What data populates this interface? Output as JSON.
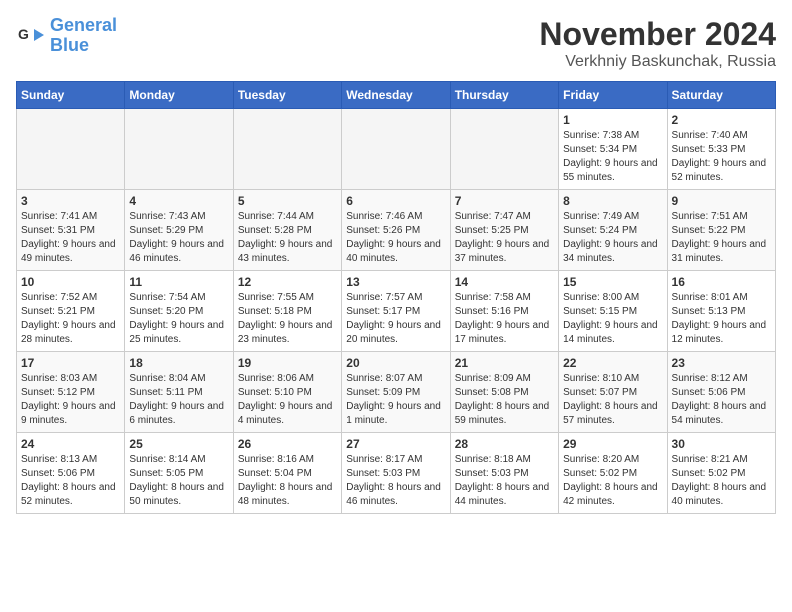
{
  "header": {
    "logo_general": "General",
    "logo_blue": "Blue",
    "month_title": "November 2024",
    "location": "Verkhniy Baskunchak, Russia"
  },
  "days_of_week": [
    "Sunday",
    "Monday",
    "Tuesday",
    "Wednesday",
    "Thursday",
    "Friday",
    "Saturday"
  ],
  "weeks": [
    [
      {
        "day": "",
        "info": ""
      },
      {
        "day": "",
        "info": ""
      },
      {
        "day": "",
        "info": ""
      },
      {
        "day": "",
        "info": ""
      },
      {
        "day": "",
        "info": ""
      },
      {
        "day": "1",
        "info": "Sunrise: 7:38 AM\nSunset: 5:34 PM\nDaylight: 9 hours and 55 minutes."
      },
      {
        "day": "2",
        "info": "Sunrise: 7:40 AM\nSunset: 5:33 PM\nDaylight: 9 hours and 52 minutes."
      }
    ],
    [
      {
        "day": "3",
        "info": "Sunrise: 7:41 AM\nSunset: 5:31 PM\nDaylight: 9 hours and 49 minutes."
      },
      {
        "day": "4",
        "info": "Sunrise: 7:43 AM\nSunset: 5:29 PM\nDaylight: 9 hours and 46 minutes."
      },
      {
        "day": "5",
        "info": "Sunrise: 7:44 AM\nSunset: 5:28 PM\nDaylight: 9 hours and 43 minutes."
      },
      {
        "day": "6",
        "info": "Sunrise: 7:46 AM\nSunset: 5:26 PM\nDaylight: 9 hours and 40 minutes."
      },
      {
        "day": "7",
        "info": "Sunrise: 7:47 AM\nSunset: 5:25 PM\nDaylight: 9 hours and 37 minutes."
      },
      {
        "day": "8",
        "info": "Sunrise: 7:49 AM\nSunset: 5:24 PM\nDaylight: 9 hours and 34 minutes."
      },
      {
        "day": "9",
        "info": "Sunrise: 7:51 AM\nSunset: 5:22 PM\nDaylight: 9 hours and 31 minutes."
      }
    ],
    [
      {
        "day": "10",
        "info": "Sunrise: 7:52 AM\nSunset: 5:21 PM\nDaylight: 9 hours and 28 minutes."
      },
      {
        "day": "11",
        "info": "Sunrise: 7:54 AM\nSunset: 5:20 PM\nDaylight: 9 hours and 25 minutes."
      },
      {
        "day": "12",
        "info": "Sunrise: 7:55 AM\nSunset: 5:18 PM\nDaylight: 9 hours and 23 minutes."
      },
      {
        "day": "13",
        "info": "Sunrise: 7:57 AM\nSunset: 5:17 PM\nDaylight: 9 hours and 20 minutes."
      },
      {
        "day": "14",
        "info": "Sunrise: 7:58 AM\nSunset: 5:16 PM\nDaylight: 9 hours and 17 minutes."
      },
      {
        "day": "15",
        "info": "Sunrise: 8:00 AM\nSunset: 5:15 PM\nDaylight: 9 hours and 14 minutes."
      },
      {
        "day": "16",
        "info": "Sunrise: 8:01 AM\nSunset: 5:13 PM\nDaylight: 9 hours and 12 minutes."
      }
    ],
    [
      {
        "day": "17",
        "info": "Sunrise: 8:03 AM\nSunset: 5:12 PM\nDaylight: 9 hours and 9 minutes."
      },
      {
        "day": "18",
        "info": "Sunrise: 8:04 AM\nSunset: 5:11 PM\nDaylight: 9 hours and 6 minutes."
      },
      {
        "day": "19",
        "info": "Sunrise: 8:06 AM\nSunset: 5:10 PM\nDaylight: 9 hours and 4 minutes."
      },
      {
        "day": "20",
        "info": "Sunrise: 8:07 AM\nSunset: 5:09 PM\nDaylight: 9 hours and 1 minute."
      },
      {
        "day": "21",
        "info": "Sunrise: 8:09 AM\nSunset: 5:08 PM\nDaylight: 8 hours and 59 minutes."
      },
      {
        "day": "22",
        "info": "Sunrise: 8:10 AM\nSunset: 5:07 PM\nDaylight: 8 hours and 57 minutes."
      },
      {
        "day": "23",
        "info": "Sunrise: 8:12 AM\nSunset: 5:06 PM\nDaylight: 8 hours and 54 minutes."
      }
    ],
    [
      {
        "day": "24",
        "info": "Sunrise: 8:13 AM\nSunset: 5:06 PM\nDaylight: 8 hours and 52 minutes."
      },
      {
        "day": "25",
        "info": "Sunrise: 8:14 AM\nSunset: 5:05 PM\nDaylight: 8 hours and 50 minutes."
      },
      {
        "day": "26",
        "info": "Sunrise: 8:16 AM\nSunset: 5:04 PM\nDaylight: 8 hours and 48 minutes."
      },
      {
        "day": "27",
        "info": "Sunrise: 8:17 AM\nSunset: 5:03 PM\nDaylight: 8 hours and 46 minutes."
      },
      {
        "day": "28",
        "info": "Sunrise: 8:18 AM\nSunset: 5:03 PM\nDaylight: 8 hours and 44 minutes."
      },
      {
        "day": "29",
        "info": "Sunrise: 8:20 AM\nSunset: 5:02 PM\nDaylight: 8 hours and 42 minutes."
      },
      {
        "day": "30",
        "info": "Sunrise: 8:21 AM\nSunset: 5:02 PM\nDaylight: 8 hours and 40 minutes."
      }
    ]
  ]
}
